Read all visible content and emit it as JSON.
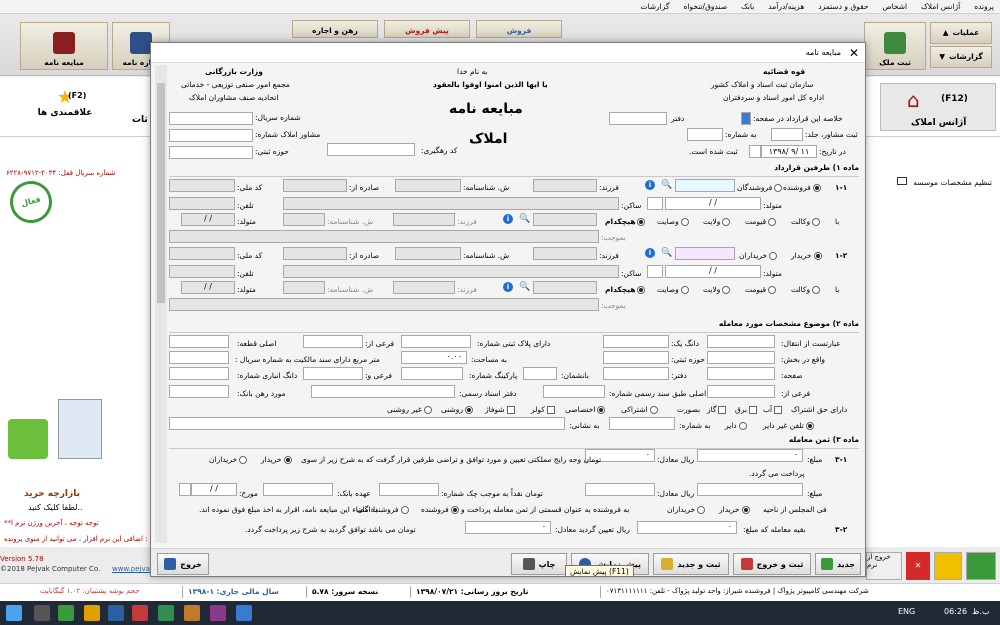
{
  "menubar": [
    "پرونده",
    "آژانس املاک",
    "اشخاص",
    "حقوق و دستمزد",
    "هزینه/درآمد",
    "بانک",
    "صندوق/تنخواه",
    "گزارشات"
  ],
  "ribbon": {
    "left_buttons": [
      "مبایعه نامه",
      "اجاره نامه"
    ],
    "tabs": [
      "رهن و اجاره",
      "پیش فروش",
      "فروش"
    ],
    "right_buttons": [
      "عملیات",
      "گزارشات",
      "ثبت ملک"
    ],
    "agency_button": "(F12)",
    "agency_label": "آژانس املاک",
    "fav_label": "علاقمندی ها",
    "fav_key": "(F2)",
    "partial_label": "ثات"
  },
  "left": {
    "serial": "شماره سریال قفل: ۲۰۳۴-۹۷۱۲-۶۲۲۸",
    "active_stamp": "فعال",
    "buy_title": "بازارچه خرید",
    "buy_sub": "لطفا کلیک کنید..",
    "notice1": "**توجه توجه ، آخرین ورژن نرم ا",
    "notice2": "اضافی این نرم افزار ، می توانید از منوی پرونده :",
    "version": "Version 5.78",
    "copyright": "©2018 Pejvak Computer Co.",
    "site": "www.pejvaksy"
  },
  "right": {
    "search_label": "تنظیم مشخصات موسسه",
    "exit_label": "خروج از نرم"
  },
  "dialog": {
    "title": "مبایعه نامه",
    "header_left1": "وزارت بازرگانی",
    "header_left2": "مجمع امور صنفی توزیعی - خدماتی",
    "header_left3": "اتحادیه صنف مشاوران املاک",
    "header_mid1": "به نام خدا",
    "header_mid2": "یا ایها الذین امنوا اوفوا بالعقود",
    "header_right1": "قوه قضائیه",
    "header_right2": "سازمان ثبت اسناد و املاک کشور",
    "header_right3": "اداره کل امور اسناد و سردفتران",
    "big1": "مبایعه نامه",
    "big2": "املاک",
    "serial_label": "شماره سریال:",
    "consult_label": "مشاور املاک شماره:",
    "area_label": "حوزه ثبتی:",
    "track_label": "کد رهگیری:",
    "summary_label": "خلاصه این قرارداد در صفحه:",
    "office_label": "دفتر",
    "consult_reg_label": "ثبت مشاور، جلد:",
    "number_label": "به شماره:",
    "date_label": "در تاریخ:",
    "date_value": "۱۳۹۸/ ۹/ ۱۱",
    "registered": "ثبت شده است.",
    "sec1": "ماده ۱) طرفین قرارداد",
    "sec2": "ماده ۲) موضوع مشخصات مورد معامله",
    "sec3": "ماده ۳) ثمن معامله",
    "seller_num": "۱-۱",
    "buyer_num": "۱-۲",
    "seller": "فروشنده",
    "sellers": "فروشندگان",
    "buyer": "خریدار",
    "buyers": "خریداران",
    "father": "فرزند:",
    "idno": "ش. شناسنامه:",
    "issued": "صادره از:",
    "natcode": "کد ملی:",
    "born": "متولد:",
    "resident": "ساکن:",
    "phone": "تلفن:",
    "slash": "/  /",
    "proxy": "وکالت",
    "guard": "قیومت",
    "guardian": "ولایت",
    "trustee": "وصایت",
    "none": "هیچکدام",
    "with": "با",
    "by_order": "بموجب:",
    "transfer": "عبارتست از انتقال:",
    "dang": "دانگ یک:",
    "plate": "دارای پلاک ثبتی شماره:",
    "sub": "فرعی از:",
    "main": "اصلی قطعه:",
    "located": "واقع در بخش:",
    "reg_area": "حوزه ثبتی:",
    "size": "به مساحت:",
    "size_value": "۰.۰۰",
    "deed": "متر مربع دارای سند مالکیت به شماره سریال :",
    "page": "صفحه:",
    "office2": "دفتر:",
    "floor": "بانشمان:",
    "parking": "پارکینگ شماره:",
    "sub2": "فرعی و:",
    "store": "دانگ انباری شماره:",
    "sub3": "فرعی از:",
    "main2": "اصلی طبق سند رسمی شماره:",
    "notary": "دفتر اسناد رسمی:",
    "bank": "مورد رهن بانک:",
    "rights": "دارای حق اشتراک",
    "water": "آب",
    "power": "برق",
    "gas": "گاز",
    "phone_line": "تلفن",
    "phone_kind": "تلفن غیر دایر",
    "active": "دایر",
    "number2": "به شماره:",
    "address": "به نشانی:",
    "ownership": "اشتراکی",
    "private": "اختصاصی",
    "kolor": "کولر",
    "shofaj": "شوفاژ",
    "roshani": "روشنی",
    "ghroshani": "غیر روشنی",
    "buyer_rest": "بصورت",
    "price_num": "۳-۱",
    "price_label": "مبلغ:",
    "price_unit": "ریال معادل:",
    "price_text": "تومان وجه رایج مملکتی تعیین و مورد توافق و تراضی طرفین قرار گرفت که به شرح زیر از سوی",
    "price_paid": "پرداخت می گردد.",
    "cash_text": "تومان نقداً به موجب چک شماره:",
    "bank_label": "عهده بانک:",
    "dated": "مورخ:",
    "council": "فی المجلس از ناحیه",
    "as": "به فروشنده به عنوان قسمتی از ثمن معامله پرداخت و",
    "signed": "با امضاء این مبایعه نامه، اقرار به اخذ مبلغ فوق نموده اند.",
    "seller_w": "فروشنده گان",
    "rest_num": "۳-۲",
    "rest_text": "بقیه معامله که مبلغ:",
    "rest_text2": "ریال تعیین گردید معادل:",
    "rest_text3": "تومان می باشد توافق گردید به شرح زیر پرداخت گردد.",
    "zero": "۰",
    "buttons": [
      "جدید",
      "ثبت و خروج",
      "ثبت و جدید",
      "پیش نمایش",
      "چاپ",
      "خروج"
    ],
    "tooltip": "پیش نمایش (F11)"
  },
  "statusbar": {
    "company": "شرکت مهندسی کامپیوتر پژواک | فروشنده شیراز: واحد تولید پژواک - تلفن: ۰۷۱۳۱۱۱۱۱۱۱",
    "update": "تاریخ بروز رسانی: ۱۳۹۸/۰۷/۲۱",
    "version": "نسخه سرور: ۵.۷۸",
    "fiscal": "سال مالی جاری: ۱-۱۳۹۸",
    "db": "حجم بوشه پشتیبان: ۱.۰۲ گیگابایت"
  },
  "taskbar": {
    "lang": "ENG",
    "time": "06:26",
    "ampm": "ب.ظ"
  }
}
